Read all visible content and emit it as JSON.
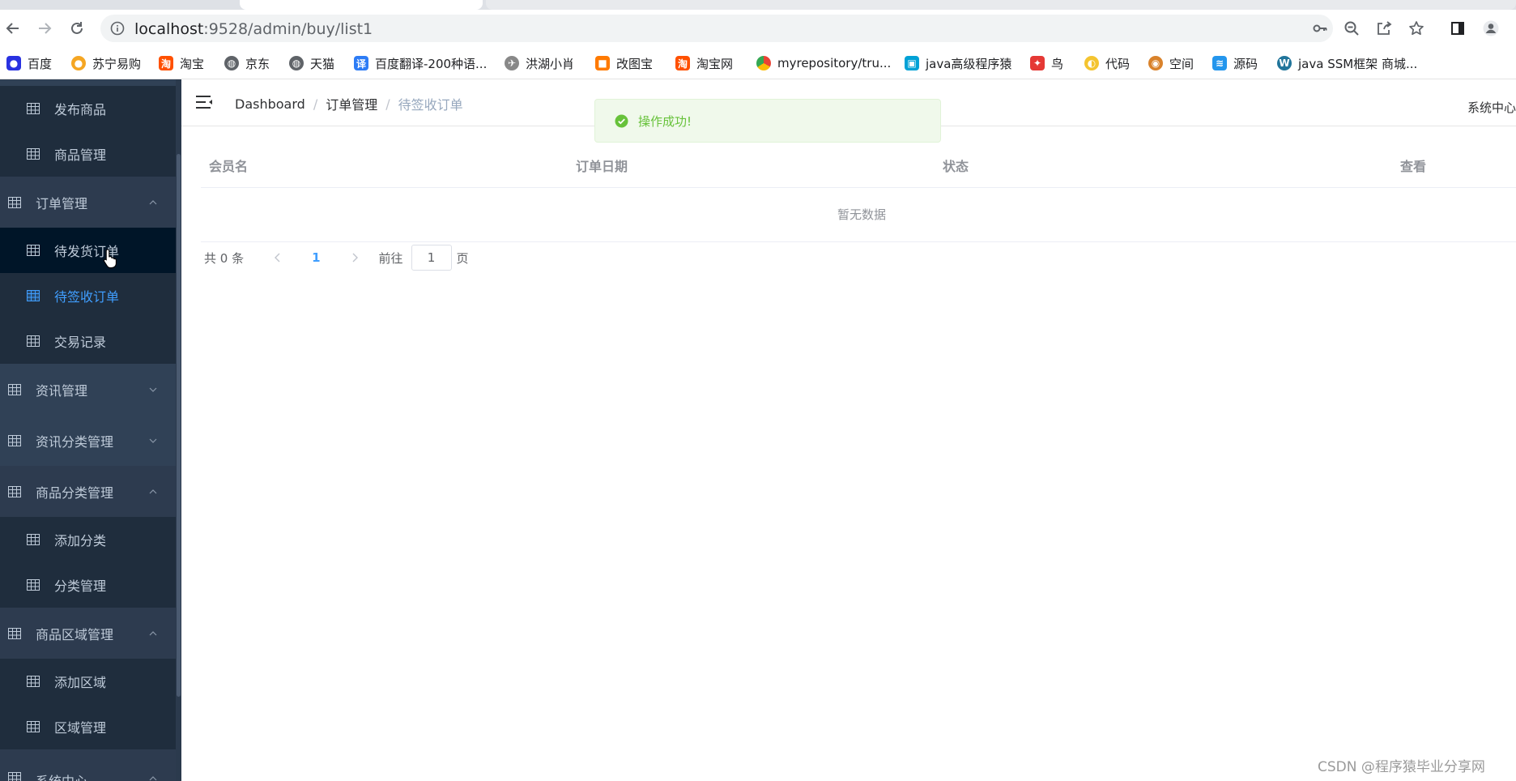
{
  "browser": {
    "url_host": "localhost",
    "url_path": ":9528/admin/buy/list1",
    "bookmarks": [
      {
        "label": "百度",
        "icon": "baidu-paw-icon",
        "color": "#2932e1"
      },
      {
        "label": "苏宁易购",
        "icon": "suning-icon",
        "color": "#f5a623"
      },
      {
        "label": "淘宝",
        "icon": "taobao-icon",
        "color": "#ff5000"
      },
      {
        "label": "京东",
        "icon": "globe-icon",
        "color": "#5f6368"
      },
      {
        "label": "天猫",
        "icon": "globe-icon",
        "color": "#5f6368"
      },
      {
        "label": "百度翻译-200种语...",
        "icon": "translate-icon",
        "color": "#2d7cf5"
      },
      {
        "label": "洪湖小肖",
        "icon": "bird-icon",
        "color": "#666666"
      },
      {
        "label": "改图宝",
        "icon": "gaitubao-icon",
        "color": "#ff7a00"
      },
      {
        "label": "淘宝网",
        "icon": "taobao-icon",
        "color": "#ff5000"
      },
      {
        "label": "myrepository/tru...",
        "icon": "chrome-icon",
        "color": "#4285f4"
      },
      {
        "label": "java高级程序猿",
        "icon": "bilibili-icon",
        "color": "#00a1d6"
      },
      {
        "label": "鸟",
        "icon": "swallow-icon",
        "color": "#e53935"
      },
      {
        "label": "代码",
        "icon": "code-icon",
        "color": "#f4c430"
      },
      {
        "label": "空间",
        "icon": "space-icon",
        "color": "#d9822b"
      },
      {
        "label": "源码",
        "icon": "docker-icon",
        "color": "#2496ed"
      },
      {
        "label": "java SSM框架 商城...",
        "icon": "wordpress-icon",
        "color": "#21759b"
      }
    ]
  },
  "sidebar": {
    "items": [
      {
        "label": "发布商品",
        "kind": "sub"
      },
      {
        "label": "商品管理",
        "kind": "sub"
      },
      {
        "label": "订单管理",
        "kind": "group",
        "expanded": true
      },
      {
        "label": "待发货订单",
        "kind": "sub",
        "state": "hover"
      },
      {
        "label": "待签收订单",
        "kind": "sub",
        "state": "active"
      },
      {
        "label": "交易记录",
        "kind": "sub"
      },
      {
        "label": "资讯管理",
        "kind": "group",
        "expanded": false
      },
      {
        "label": "资讯分类管理",
        "kind": "group",
        "expanded": false
      },
      {
        "label": "商品分类管理",
        "kind": "group",
        "expanded": true
      },
      {
        "label": "添加分类",
        "kind": "sub"
      },
      {
        "label": "分类管理",
        "kind": "sub"
      },
      {
        "label": "商品区域管理",
        "kind": "group",
        "expanded": true
      },
      {
        "label": "添加区域",
        "kind": "sub"
      },
      {
        "label": "区域管理",
        "kind": "sub"
      },
      {
        "label": "系统中心",
        "kind": "group",
        "expanded": true
      }
    ]
  },
  "navbar": {
    "breadcrumb": [
      "Dashboard",
      "订单管理",
      "待签收订单"
    ],
    "right_menu": "系统中心"
  },
  "toast": {
    "message": "操作成功!",
    "type": "success"
  },
  "table": {
    "columns": [
      "会员名",
      "订单日期",
      "状态",
      "查看"
    ],
    "empty_text": "暂无数据"
  },
  "pagination": {
    "total_text": "共 0 条",
    "current_page": "1",
    "goto_label": "前往",
    "goto_value": "1",
    "page_suffix": "页"
  },
  "watermark": "CSDN @程序猿毕业分享网",
  "colors": {
    "sidebar_bg": "#304156",
    "submenu_bg": "#1f2d3d",
    "active": "#409eff",
    "success": "#67c23a"
  }
}
